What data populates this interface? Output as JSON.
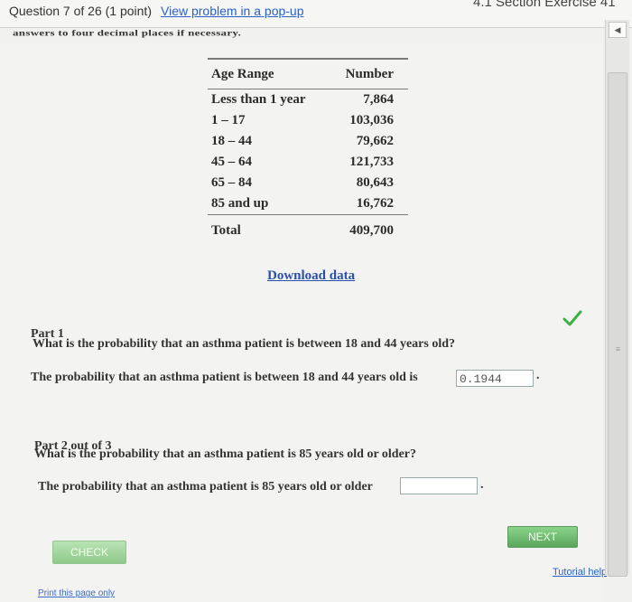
{
  "header": {
    "question_info": "Question 7 of 26 (1 point)",
    "popup_link": "View problem in a pop-up",
    "section_title": "4.1 Section Exercise 41"
  },
  "instructions_fragment": "answers to four decimal places if necessary.",
  "table": {
    "headers": [
      "Age Range",
      "Number"
    ],
    "rows": [
      {
        "range": "Less than 1 year",
        "number": "7,864"
      },
      {
        "range": "1 – 17",
        "number": "103,036"
      },
      {
        "range": "18 – 44",
        "number": "79,662"
      },
      {
        "range": "45 – 64",
        "number": "121,733"
      },
      {
        "range": "65 – 84",
        "number": "80,643"
      },
      {
        "range": "85 and up",
        "number": "16,762"
      }
    ],
    "total": {
      "label": "Total",
      "number": "409,700"
    }
  },
  "download_link": "Download data",
  "part1": {
    "title": "Part 1",
    "question": "What is the probability that an asthma patient is between 18 and 44 years old?",
    "answer_prompt": "The probability that an asthma patient is between 18 and 44 years old is",
    "answer_value": "0.1944",
    "status": "correct",
    "status_color": "#3cb043"
  },
  "part2": {
    "title": "Part 2 out of 3",
    "question": "What is the probability that an asthma patient is 85 years old or older?",
    "answer_prompt": "The probability that an asthma patient is 85 years old or older",
    "answer_value": ""
  },
  "buttons": {
    "next": "NEXT",
    "check": "CHECK"
  },
  "links": {
    "tutorial": "Tutorial help",
    "print": "Print this page only"
  },
  "colors": {
    "accent_green": "#5aa65b",
    "link_blue": "#2a62c9"
  }
}
